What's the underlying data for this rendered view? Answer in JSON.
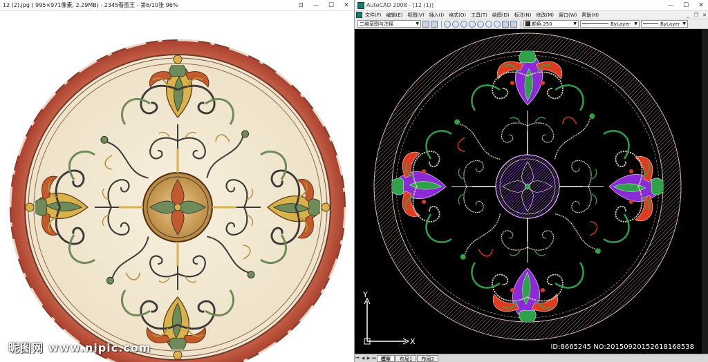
{
  "viewer": {
    "title": "12 (2).jpg ( 995×971像素, 2.29MB) - 2345看图王 - 第6/10张 96%",
    "controls": {
      "pin": "⊡",
      "minimize": "—",
      "maximize": "☐",
      "close": "✕"
    }
  },
  "cad": {
    "title": "AutoCAD 2008 - [12 (1)]",
    "window_controls": {
      "minimize": "—",
      "maximize": "☐",
      "close": "✕"
    },
    "menus": [
      "文件(F)",
      "编辑(E)",
      "视图(V)",
      "插入(I)",
      "格式(O)",
      "工具(T)",
      "绘图(D)",
      "标注(N)",
      "修改(M)",
      "窗口(W)",
      "帮助(H)"
    ],
    "doc_controls": {
      "minimize": "_",
      "restore": "❐",
      "close": "✕"
    },
    "toolbar": {
      "workspace": "二维草图与注释",
      "color": "颜色 250",
      "linetype": "ByLayer",
      "lineweight": "ByLayer"
    },
    "axis": {
      "y_label": "Y",
      "x_label": "X"
    },
    "status": {
      "tabs": [
        "模型",
        "布局1",
        "布局2"
      ],
      "nav": [
        "⏮",
        "◀",
        "▶",
        "⏭"
      ]
    }
  },
  "watermark": {
    "left": "昵图网 www.nipic.com",
    "right": "ID:8665245 NO:20150920152618168538"
  },
  "colors": {
    "marble_cream": "#f3ead6",
    "marble_red": "#c2533d",
    "gold": "#d9b24c",
    "cad_purple": "#8a2bd6",
    "cad_red": "#e03b1f",
    "cad_green": "#2ea14a",
    "cad_ring": "#a07a7a"
  }
}
